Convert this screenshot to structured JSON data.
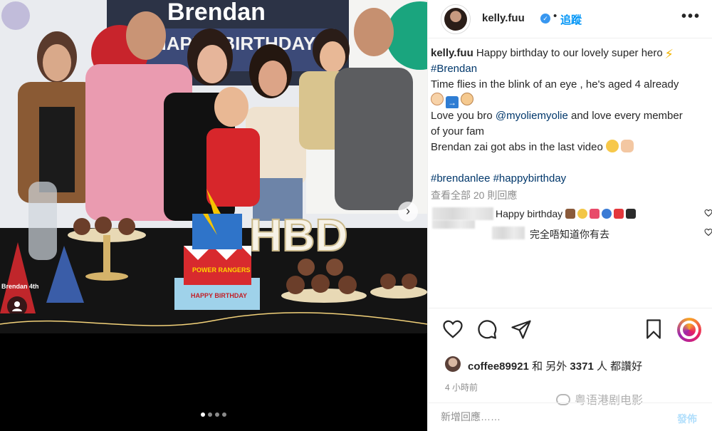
{
  "photo": {
    "banner_name": "Brendan",
    "banner_sub": "HAPPY BIRTHDAY",
    "cake_label": "HAPPY BIRTHDAY",
    "cake_brand": "POWER RANGERS",
    "letters": "HBD",
    "hat_text": "Brendan 4th",
    "carousel_pages": 4,
    "carousel_active": 0
  },
  "header": {
    "username": "kelly.fuu",
    "separator": "•",
    "follow_label": "追蹤",
    "more_label": "•••"
  },
  "caption": {
    "username": "kelly.fuu",
    "line1": " Happy birthday to our lovely super hero",
    "hashtag1": "#Brendan",
    "line3": "Time flies in the blink of an eye , he's aged 4 already",
    "line5a": "Love you bro ",
    "mention": "@myoliemyolie",
    "line5b": " and love every member",
    "line6": "of your fam",
    "line7": "Brendan zai got abs in the last video",
    "hashtag2": "#brendanlee",
    "hashtag3": "#happybirthday"
  },
  "view_all": "查看全部 20 則回應",
  "comments": [
    {
      "text": "Happy birthday"
    },
    {
      "text": "完全唔知道你有去"
    }
  ],
  "likes": {
    "user": "coffee89921",
    "middle": " 和 另外 ",
    "count": "3371",
    "suffix": " 人 都讚好"
  },
  "time": "4 小時前",
  "watermark": "粤语港剧电影",
  "comment_box": {
    "placeholder": "新增回應……",
    "post_label": "發佈"
  },
  "colors": {
    "link": "#00376b",
    "follow": "#0095f6",
    "verified": "#3897f0",
    "muted": "#8e8e8e",
    "post_disabled": "#b2dffc"
  },
  "icons": {
    "like": "heart-icon",
    "comment": "comment-icon",
    "share": "paper-plane-icon",
    "save": "bookmark-icon",
    "more": "ellipsis-icon"
  }
}
